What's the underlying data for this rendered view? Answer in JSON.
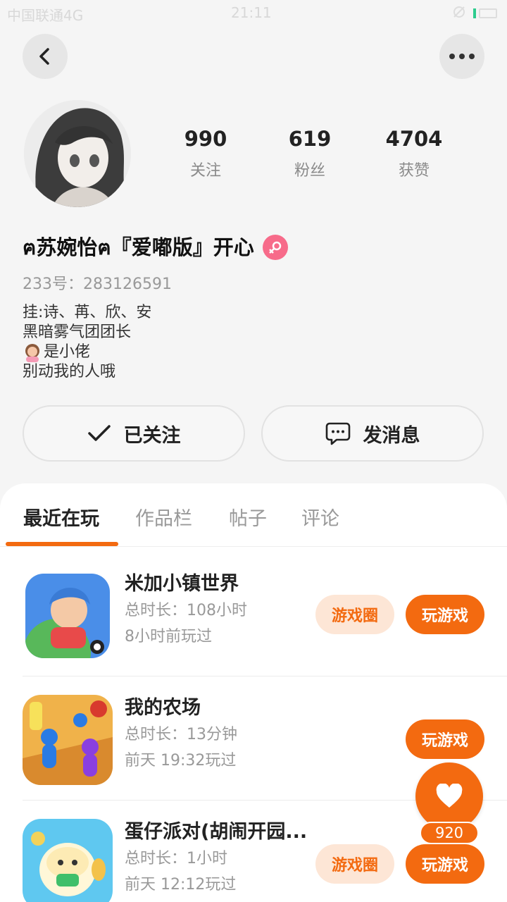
{
  "status_bar": {
    "carrier": "中国联通4G",
    "time": "21:11"
  },
  "profile": {
    "stats": [
      {
        "value": "990",
        "label": "关注"
      },
      {
        "value": "619",
        "label": "粉丝"
      },
      {
        "value": "4704",
        "label": "获赞"
      }
    ],
    "name": "ฅ苏婉怡ฅ『爱嘟版』开心",
    "user_id": "233号：283126591",
    "bio": [
      "挂:诗、苒、欣、安",
      "黑暗雾气团团长",
      "是小佬",
      "别动我的人哦"
    ],
    "follow_button": "已关注",
    "message_button": "发消息"
  },
  "tabs": [
    "最近在玩",
    "作品栏",
    "帖子",
    "评论"
  ],
  "games": [
    {
      "title": "米加小镇世界",
      "total": "总时长：108小时",
      "last": "8小时前玩过",
      "circle_label": "游戏圈",
      "play_label": "玩游戏"
    },
    {
      "title": "我的农场",
      "total": "总时长：13分钟",
      "last": "前天 19:32玩过",
      "circle_label": "",
      "play_label": "玩游戏"
    },
    {
      "title": "蛋仔派对(胡闹开园...",
      "total": "总时长：1小时",
      "last": "前天 12:12玩过",
      "circle_label": "游戏圈",
      "play_label": "玩游戏"
    }
  ],
  "fab": {
    "count": "920",
    "icon": "heart-icon"
  },
  "colors": {
    "accent": "#f36a10",
    "gender_badge": "#f76b8a"
  }
}
